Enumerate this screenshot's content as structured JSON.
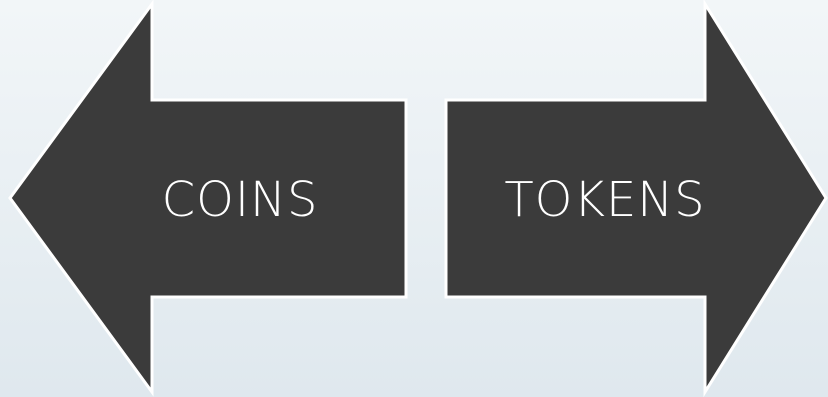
{
  "diagram": {
    "left_arrow": {
      "label": "COINS",
      "direction": "left"
    },
    "right_arrow": {
      "label": "TOKENS",
      "direction": "right"
    }
  },
  "colors": {
    "arrow_fill": "#3b3b3b",
    "arrow_stroke": "#ffffff",
    "label_color": "#ffffff",
    "background_top": "#f2f6f8",
    "background_bottom": "#dfe8ee"
  }
}
